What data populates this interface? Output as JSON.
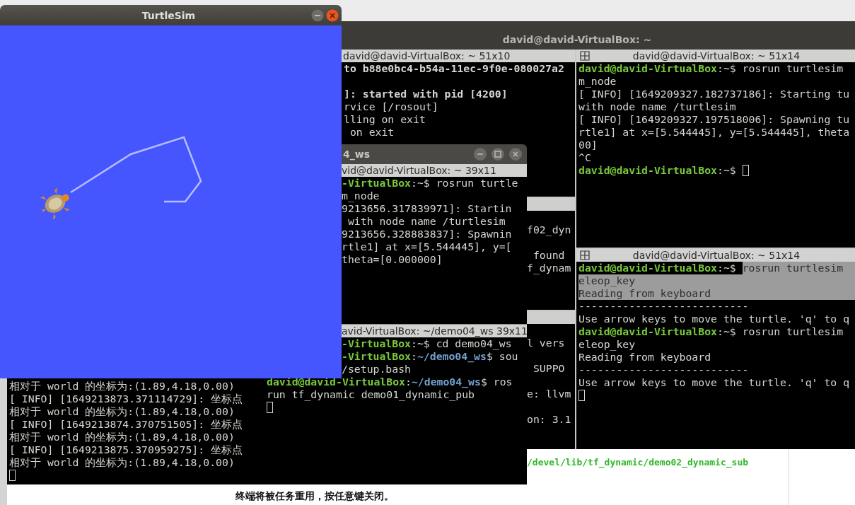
{
  "turtlesim": {
    "title": "TurtleSim"
  },
  "main_terminal": {
    "title": "david@david-VirtualBox: ~",
    "panes": [
      {
        "title": "david@david-VirtualBox: ~ 51x10",
        "lines": [
          [
            {
              "kind": "bold",
              "t": "to b88e0bc4-b54a-11ec-9f0e-080027a2"
            }
          ],
          [
            {
              "kind": "bold",
              "t": "]: started with pid [4200]"
            }
          ],
          [
            {
              "kind": "plain",
              "t": "rvice [/rosout]"
            }
          ],
          [
            {
              "kind": "plain",
              "t": "lling on exit"
            }
          ],
          [
            {
              "kind": "plain",
              "t": " on exit"
            }
          ]
        ]
      },
      {
        "lines": [
          [
            {
              "kind": "plain",
              "t": "f02_dyn"
            }
          ],
          [
            {
              "kind": "plain",
              "t": " found"
            }
          ],
          [
            {
              "kind": "plain",
              "t": "f_dynam"
            }
          ]
        ]
      },
      {
        "lines": [
          [
            {
              "kind": "plain",
              "t": "l vers"
            }
          ],
          [
            {
              "kind": "plain",
              "t": " SUPPO"
            }
          ],
          [
            {
              "kind": "plain",
              "t": "e: llvm"
            }
          ],
          [
            {
              "kind": "plain",
              "t": "on: 3.1"
            }
          ]
        ]
      },
      {
        "title": "david@david-VirtualBox: ~ 51x14",
        "lines": [
          [
            {
              "kind": "user",
              "t": "david@david-VirtualBox"
            },
            {
              "kind": "plain",
              "t": ":~$ rosrun turtlesim "
            }
          ],
          [
            {
              "kind": "plain",
              "t": "m_node"
            }
          ],
          [
            {
              "kind": "plain",
              "t": "[ INFO] [1649209327.182737186]: Starting tu"
            }
          ],
          [
            {
              "kind": "plain",
              "t": "with node name /turtlesim"
            }
          ],
          [
            {
              "kind": "plain",
              "t": "[ INFO] [1649209327.197518006]: Spawning tu"
            }
          ],
          [
            {
              "kind": "plain",
              "t": "rtle1] at x=[5.544445], y=[5.544445], theta"
            }
          ],
          [
            {
              "kind": "plain",
              "t": "00]"
            }
          ],
          [
            {
              "kind": "plain",
              "t": "^C"
            }
          ],
          [
            {
              "kind": "user",
              "t": "david@david-VirtualBox"
            },
            {
              "kind": "plain",
              "t": ":~$ "
            },
            {
              "kind": "cursor"
            }
          ]
        ]
      },
      {
        "title": "david@david-VirtualBox: ~ 51x14",
        "lines": [
          [
            {
              "kind": "user",
              "t": "david@david-VirtualBox"
            },
            {
              "kind": "plain",
              "t": ":~$ "
            },
            {
              "kind": "selected",
              "t": "rosrun turtlesim "
            }
          ],
          [
            {
              "kind": "selected",
              "t": "eleop_key"
            }
          ],
          [
            {
              "kind": "selected",
              "t": "Reading from keyboard"
            }
          ],
          [
            {
              "kind": "plain",
              "t": "---------------------------"
            }
          ],
          [
            {
              "kind": "plain",
              "t": "Use arrow keys to move the turtle. 'q' to q"
            }
          ],
          [
            {
              "kind": "user",
              "t": "david@david-VirtualBox"
            },
            {
              "kind": "plain",
              "t": ":~$ rosrun turtlesim "
            }
          ],
          [
            {
              "kind": "plain",
              "t": "eleop_key"
            }
          ],
          [
            {
              "kind": "plain",
              "t": "Reading from keyboard"
            }
          ],
          [
            {
              "kind": "plain",
              "t": "---------------------------"
            }
          ],
          [
            {
              "kind": "plain",
              "t": "Use arrow keys to move the turtle. 'q' to q"
            }
          ],
          [
            {
              "kind": "cursor"
            }
          ]
        ]
      }
    ]
  },
  "middle_terminal": {
    "title": "4_ws",
    "panes": [
      {
        "title": "vid@david-VirtualBox: ~ 39x11",
        "lines": [
          [
            {
              "kind": "user",
              "t": "-VirtualBox"
            },
            {
              "kind": "plain",
              "t": ":~$ rosrun turtle"
            }
          ],
          [
            {
              "kind": "plain",
              "t": "m_node"
            }
          ],
          [
            {
              "kind": "plain",
              "t": "9213656.317839971]: Startin"
            }
          ],
          [
            {
              "kind": "plain",
              "t": " with node name /turtlesim"
            }
          ],
          [
            {
              "kind": "plain",
              "t": "9213656.328883837]: Spawnin"
            }
          ],
          [
            {
              "kind": "plain",
              "t": "rtle1] at x=[5.544445], y=["
            }
          ],
          [
            {
              "kind": "plain",
              "t": "theta=[0.000000]"
            }
          ]
        ]
      },
      {
        "title": "avid-VirtualBox: ~/demo04_ws 39x11",
        "lines": [
          [
            {
              "kind": "user",
              "t": "-VirtualBox"
            },
            {
              "kind": "plain",
              "t": ":~$ cd demo04_ws"
            }
          ],
          [
            {
              "kind": "user",
              "t": "-VirtualBox"
            },
            {
              "kind": "plain",
              "t": ":"
            },
            {
              "kind": "path",
              "t": "~/demo04_ws"
            },
            {
              "kind": "plain",
              "t": "$ sou"
            }
          ],
          [
            {
              "kind": "plain",
              "t": "/setup.bash"
            }
          ],
          [
            {
              "kind": "user",
              "t": "david@david-VirtualBox"
            },
            {
              "kind": "plain",
              "t": ":"
            },
            {
              "kind": "path",
              "t": "~/demo04_ws"
            },
            {
              "kind": "plain",
              "t": "$ ros"
            }
          ],
          [
            {
              "kind": "plain",
              "t": "run tf_dynamic demo01_dynamic_pub"
            }
          ],
          [
            {
              "kind": "cursor"
            }
          ]
        ]
      }
    ]
  },
  "bottom_terminal": {
    "lines": [
      [
        {
          "kind": "plain",
          "t": "相对于 world 的坐标为:(1.89,4.18,0.00)"
        }
      ],
      [
        {
          "kind": "plain",
          "t": "[ INFO] [1649213873.371114729]: 坐标点"
        }
      ],
      [
        {
          "kind": "plain",
          "t": "相对于 world 的坐标为:(1.89,4.18,0.00)"
        }
      ],
      [
        {
          "kind": "plain",
          "t": "[ INFO] [1649213874.370751505]: 坐标点"
        }
      ],
      [
        {
          "kind": "plain",
          "t": "相对于 world 的坐标为:(1.89,4.18,0.00)"
        }
      ],
      [
        {
          "kind": "plain",
          "t": "[ INFO] [1649213875.370959275]: 坐标点"
        }
      ],
      [
        {
          "kind": "plain",
          "t": "相对于 world 的坐标为:(1.89,4.18,0.00)"
        }
      ],
      [
        {
          "kind": "cursor"
        }
      ]
    ]
  },
  "document": {
    "path": "/devel/lib/tf_dynamic/demo02_dynamic_sub",
    "notice": "终端将被任务重用，按任意键关闭。"
  }
}
